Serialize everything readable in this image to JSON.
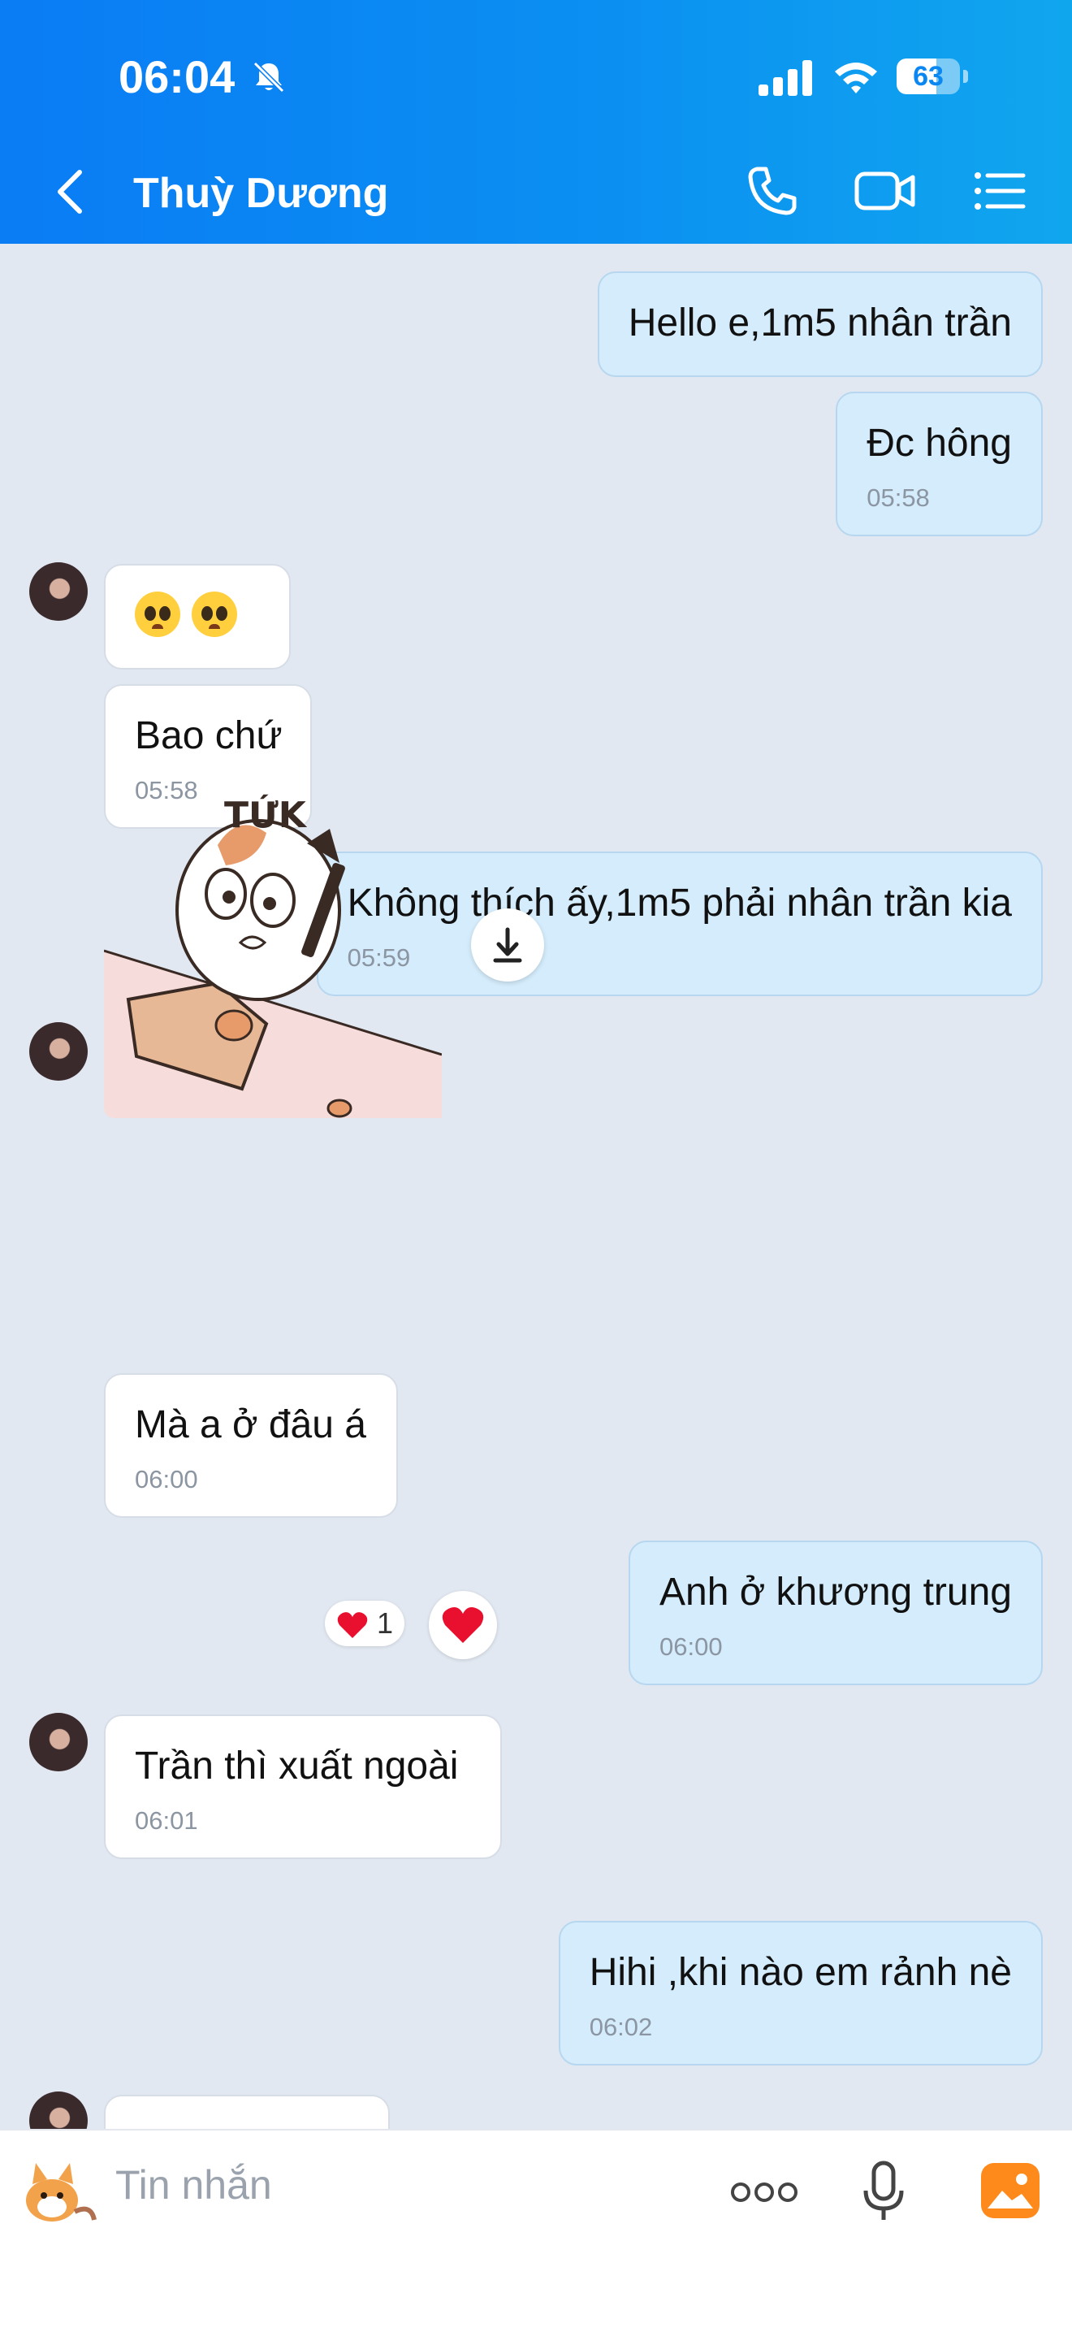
{
  "status_bar": {
    "time": "06:04",
    "battery": "63",
    "battery_level": 0.63
  },
  "header": {
    "title": "Thuỳ Dương"
  },
  "messages": [
    {
      "text": "Hello e,1m5 nhân trần"
    },
    {
      "text": "Đc hông",
      "time": "05:58"
    },
    {
      "text": "🥺🥺"
    },
    {
      "text": "Bao chứ",
      "time": "05:58"
    },
    {
      "text": "Không thích ấy,1m5 phải nhân trần kia",
      "time": "05:59"
    },
    {
      "sticker_text": "TỨK"
    },
    {
      "text": "Mà a ở đâu á",
      "time": "06:00"
    },
    {
      "text": "Anh ở khương trung",
      "time": "06:00"
    },
    {
      "text": "Trần thì xuất ngoài",
      "time": "06:01",
      "reaction_count": "1"
    },
    {
      "text": "Hihi ,khi nào em rảnh nè",
      "time": "06:02"
    }
  ],
  "composer": {
    "placeholder": "Tin nhắn"
  },
  "icons": {
    "back": "chevron-left-icon",
    "call": "phone-icon",
    "video": "video-camera-icon",
    "menu": "list-menu-icon",
    "sticker": "sticker-icon",
    "more": "more-dots-icon",
    "mic": "microphone-icon",
    "image": "image-gallery-icon",
    "download": "download-icon",
    "reaction": "heart-icon"
  },
  "colors": {
    "header_start": "#0a7cf4",
    "header_end": "#10a6ee",
    "outgoing_bubble": "#d4ecfb",
    "incoming_bubble": "#ffffff",
    "chat_bg": "#e2e8f1",
    "heart": "#e8102e",
    "image_icon": "#ff8a1c"
  }
}
